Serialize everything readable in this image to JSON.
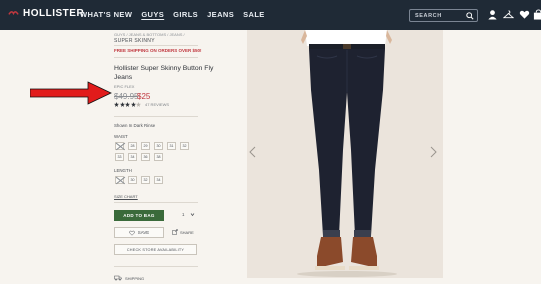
{
  "header": {
    "brand": "HOLLISTER",
    "nav": [
      "WHAT'S NEW",
      "GUYS",
      "GIRLS",
      "JEANS",
      "SALE"
    ],
    "active_nav": "GUYS",
    "search_placeholder": "SEARCH"
  },
  "product": {
    "breadcrumb": "GUYS  /  JEANS & BOTTOMS  /  JEANS  /",
    "category": "SUPER SKINNY",
    "shipping_banner": "FREE SHIPPING ON ORDERS OVER $50!",
    "title": "Hollister Super Skinny Button Fly Jeans",
    "subtitle": "EPIC FLEX",
    "old_price": "$49.95",
    "new_price": "$25",
    "reviews": "47 REVIEWS",
    "rating_stars": 4,
    "color_label": "Shown In Dark Rinse",
    "waist_label": "WAIST",
    "waist_sizes": [
      "",
      "28",
      "29",
      "30",
      "31",
      "32",
      "33",
      "34",
      "36",
      "38"
    ],
    "length_label": "LENGTH",
    "length_sizes": [
      "",
      "30",
      "32",
      "34"
    ],
    "size_guide": "SIZE CHART",
    "add_to_bag": "ADD TO BAG",
    "quantity": "1",
    "save_label": "SAVE",
    "share_label": "SHARE",
    "store_label": "CHECK STORE AVAILABILITY",
    "shipping_label": "SHIPPING"
  },
  "colors": {
    "header_bg": "#1f2a36",
    "sale_red": "#c0383f",
    "add_green": "#3a6a3a",
    "page_bg": "#f7f4ef"
  }
}
